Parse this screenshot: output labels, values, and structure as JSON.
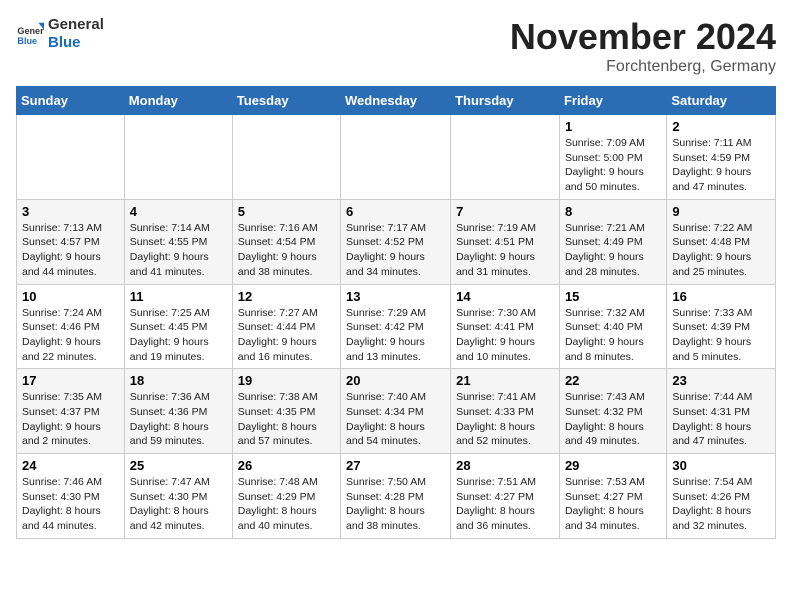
{
  "logo": {
    "line1": "General",
    "line2": "Blue"
  },
  "title": "November 2024",
  "location": "Forchtenberg, Germany",
  "weekdays": [
    "Sunday",
    "Monday",
    "Tuesday",
    "Wednesday",
    "Thursday",
    "Friday",
    "Saturday"
  ],
  "weeks": [
    [
      {
        "day": "",
        "info": ""
      },
      {
        "day": "",
        "info": ""
      },
      {
        "day": "",
        "info": ""
      },
      {
        "day": "",
        "info": ""
      },
      {
        "day": "",
        "info": ""
      },
      {
        "day": "1",
        "info": "Sunrise: 7:09 AM\nSunset: 5:00 PM\nDaylight: 9 hours and 50 minutes."
      },
      {
        "day": "2",
        "info": "Sunrise: 7:11 AM\nSunset: 4:59 PM\nDaylight: 9 hours and 47 minutes."
      }
    ],
    [
      {
        "day": "3",
        "info": "Sunrise: 7:13 AM\nSunset: 4:57 PM\nDaylight: 9 hours and 44 minutes."
      },
      {
        "day": "4",
        "info": "Sunrise: 7:14 AM\nSunset: 4:55 PM\nDaylight: 9 hours and 41 minutes."
      },
      {
        "day": "5",
        "info": "Sunrise: 7:16 AM\nSunset: 4:54 PM\nDaylight: 9 hours and 38 minutes."
      },
      {
        "day": "6",
        "info": "Sunrise: 7:17 AM\nSunset: 4:52 PM\nDaylight: 9 hours and 34 minutes."
      },
      {
        "day": "7",
        "info": "Sunrise: 7:19 AM\nSunset: 4:51 PM\nDaylight: 9 hours and 31 minutes."
      },
      {
        "day": "8",
        "info": "Sunrise: 7:21 AM\nSunset: 4:49 PM\nDaylight: 9 hours and 28 minutes."
      },
      {
        "day": "9",
        "info": "Sunrise: 7:22 AM\nSunset: 4:48 PM\nDaylight: 9 hours and 25 minutes."
      }
    ],
    [
      {
        "day": "10",
        "info": "Sunrise: 7:24 AM\nSunset: 4:46 PM\nDaylight: 9 hours and 22 minutes."
      },
      {
        "day": "11",
        "info": "Sunrise: 7:25 AM\nSunset: 4:45 PM\nDaylight: 9 hours and 19 minutes."
      },
      {
        "day": "12",
        "info": "Sunrise: 7:27 AM\nSunset: 4:44 PM\nDaylight: 9 hours and 16 minutes."
      },
      {
        "day": "13",
        "info": "Sunrise: 7:29 AM\nSunset: 4:42 PM\nDaylight: 9 hours and 13 minutes."
      },
      {
        "day": "14",
        "info": "Sunrise: 7:30 AM\nSunset: 4:41 PM\nDaylight: 9 hours and 10 minutes."
      },
      {
        "day": "15",
        "info": "Sunrise: 7:32 AM\nSunset: 4:40 PM\nDaylight: 9 hours and 8 minutes."
      },
      {
        "day": "16",
        "info": "Sunrise: 7:33 AM\nSunset: 4:39 PM\nDaylight: 9 hours and 5 minutes."
      }
    ],
    [
      {
        "day": "17",
        "info": "Sunrise: 7:35 AM\nSunset: 4:37 PM\nDaylight: 9 hours and 2 minutes."
      },
      {
        "day": "18",
        "info": "Sunrise: 7:36 AM\nSunset: 4:36 PM\nDaylight: 8 hours and 59 minutes."
      },
      {
        "day": "19",
        "info": "Sunrise: 7:38 AM\nSunset: 4:35 PM\nDaylight: 8 hours and 57 minutes."
      },
      {
        "day": "20",
        "info": "Sunrise: 7:40 AM\nSunset: 4:34 PM\nDaylight: 8 hours and 54 minutes."
      },
      {
        "day": "21",
        "info": "Sunrise: 7:41 AM\nSunset: 4:33 PM\nDaylight: 8 hours and 52 minutes."
      },
      {
        "day": "22",
        "info": "Sunrise: 7:43 AM\nSunset: 4:32 PM\nDaylight: 8 hours and 49 minutes."
      },
      {
        "day": "23",
        "info": "Sunrise: 7:44 AM\nSunset: 4:31 PM\nDaylight: 8 hours and 47 minutes."
      }
    ],
    [
      {
        "day": "24",
        "info": "Sunrise: 7:46 AM\nSunset: 4:30 PM\nDaylight: 8 hours and 44 minutes."
      },
      {
        "day": "25",
        "info": "Sunrise: 7:47 AM\nSunset: 4:30 PM\nDaylight: 8 hours and 42 minutes."
      },
      {
        "day": "26",
        "info": "Sunrise: 7:48 AM\nSunset: 4:29 PM\nDaylight: 8 hours and 40 minutes."
      },
      {
        "day": "27",
        "info": "Sunrise: 7:50 AM\nSunset: 4:28 PM\nDaylight: 8 hours and 38 minutes."
      },
      {
        "day": "28",
        "info": "Sunrise: 7:51 AM\nSunset: 4:27 PM\nDaylight: 8 hours and 36 minutes."
      },
      {
        "day": "29",
        "info": "Sunrise: 7:53 AM\nSunset: 4:27 PM\nDaylight: 8 hours and 34 minutes."
      },
      {
        "day": "30",
        "info": "Sunrise: 7:54 AM\nSunset: 4:26 PM\nDaylight: 8 hours and 32 minutes."
      }
    ]
  ]
}
